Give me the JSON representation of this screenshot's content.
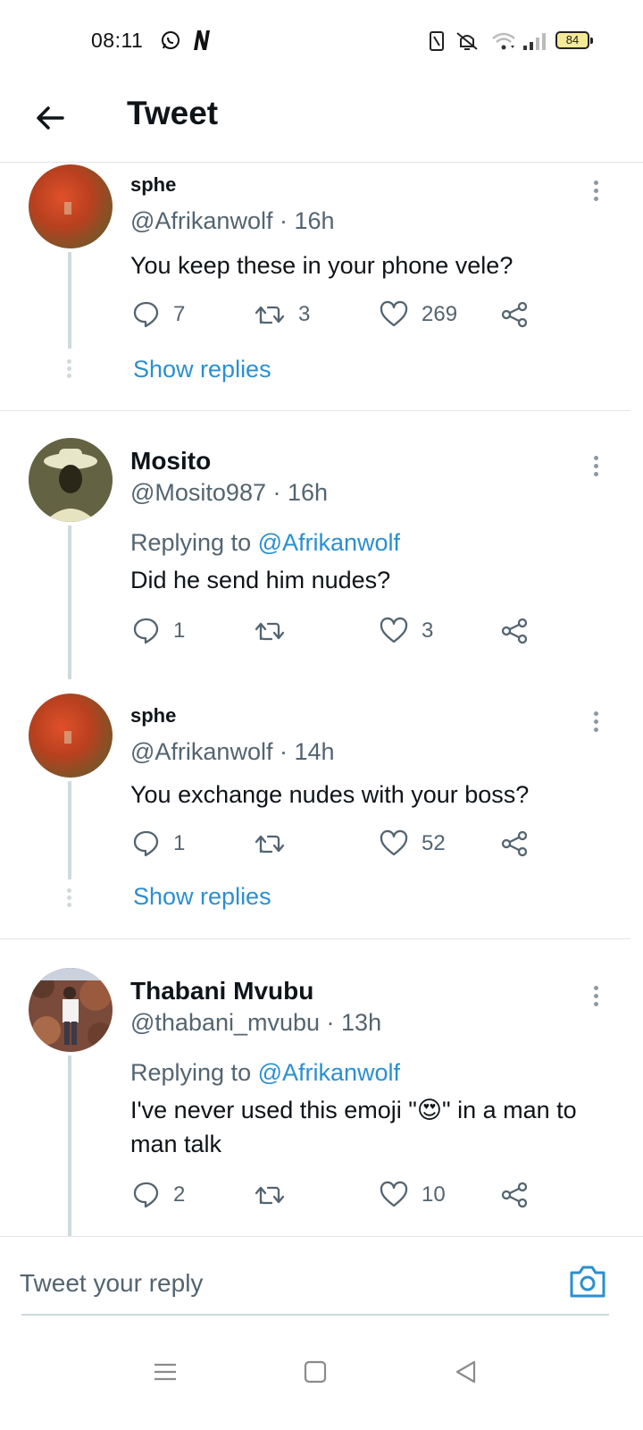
{
  "status_bar": {
    "time": "08:11",
    "battery": "84",
    "icons": [
      "whatsapp-icon",
      "notification-n-icon",
      "nfc-icon",
      "mute-icon",
      "wifi-icon",
      "signal-icon",
      "battery-icon"
    ]
  },
  "header": {
    "title": "Tweet",
    "back_icon": "arrow-left-icon"
  },
  "colors": {
    "link": "#2b8fd0",
    "secondary_text": "#536471",
    "thread_line": "#cfd9de",
    "divider": "#e1e6ea"
  },
  "tweets": [
    {
      "name": "sphe",
      "handle_time": "@Afrikanwolf · 16h",
      "text": "You keep these in your phone vele?",
      "replies": "7",
      "retweets": "3",
      "likes": "269",
      "show_replies": "Show replies"
    },
    {
      "name": "Mosito",
      "handle_time": "@Mosito987 · 16h",
      "replying_prefix": "Replying to ",
      "replying_to": "@Afrikanwolf",
      "text": "Did he send him nudes?",
      "replies": "1",
      "retweets": "",
      "likes": "3"
    },
    {
      "name": "sphe",
      "handle_time": "@Afrikanwolf · 14h",
      "text": "You exchange nudes with your boss?",
      "replies": "1",
      "retweets": "",
      "likes": "52",
      "show_replies": "Show replies"
    },
    {
      "name": "Thabani Mvubu",
      "handle_time": "@thabani_mvubu · 13h",
      "replying_prefix": "Replying to ",
      "replying_to": "@Afrikanwolf",
      "text": "I've never used this emoji \"😍\" in a man to man talk",
      "replies": "2",
      "retweets": "",
      "likes": "10"
    }
  ],
  "reply_bar": {
    "placeholder": "Tweet your reply"
  },
  "nav_bar": {
    "icons": [
      "menu-icon",
      "home-square-icon",
      "back-triangle-icon"
    ]
  }
}
